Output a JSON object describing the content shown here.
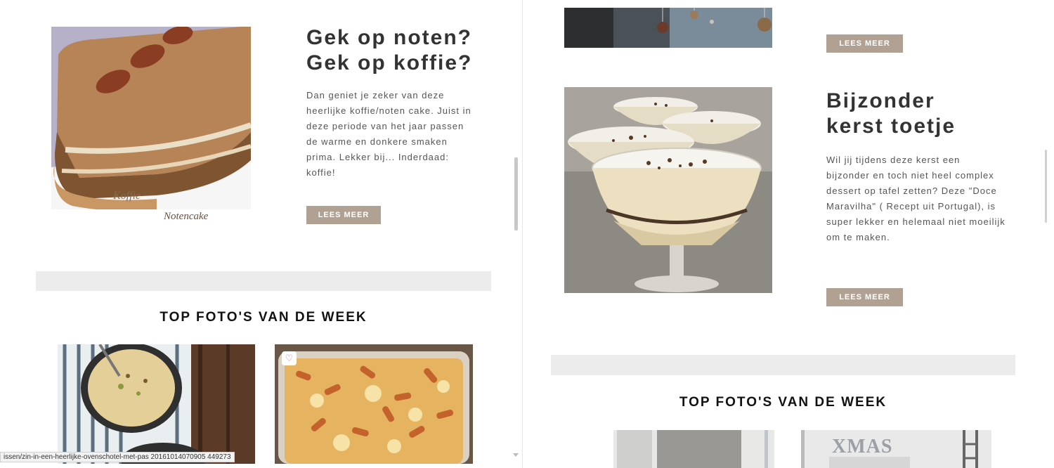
{
  "left": {
    "article": {
      "title_line1": "Gek op noten?",
      "title_line2": "Gek op koffie?",
      "body": "Dan geniet je zeker van deze heerlijke koffie/noten cake. Juist in deze periode van het jaar passen de warme en donkere smaken prima. Lekker bij... Inderdaad: koffie!",
      "button": "LEES MEER",
      "image_caption_top": "Koffie",
      "image_caption_bottom": "Notencake"
    },
    "top_photos_title": "TOP FOTO'S VAN DE WEEK"
  },
  "right": {
    "article_top": {
      "button": "LEES MEER"
    },
    "article": {
      "title_line1": "Bijzonder",
      "title_line2": "kerst toetje",
      "body": "Wil jij tijdens deze kerst een bijzonder en toch niet heel complex dessert op tafel zetten? Deze \"Doce Maravilha\" ( Recept uit Portugal), is super lekker en helemaal niet moeilijk om te maken.",
      "button": "LEES MEER"
    },
    "top_photos_title": "TOP FOTO'S VAN DE WEEK",
    "xmas_sign": "XMAS"
  },
  "status_bar": {
    "url": "issen/zin-in-een-heerlijke-ovenschotel-met-pas 20161014070905 449273"
  },
  "colors": {
    "button_bg": "#b0a193",
    "band_gray": "#ececec",
    "heart": "#e0679b"
  }
}
